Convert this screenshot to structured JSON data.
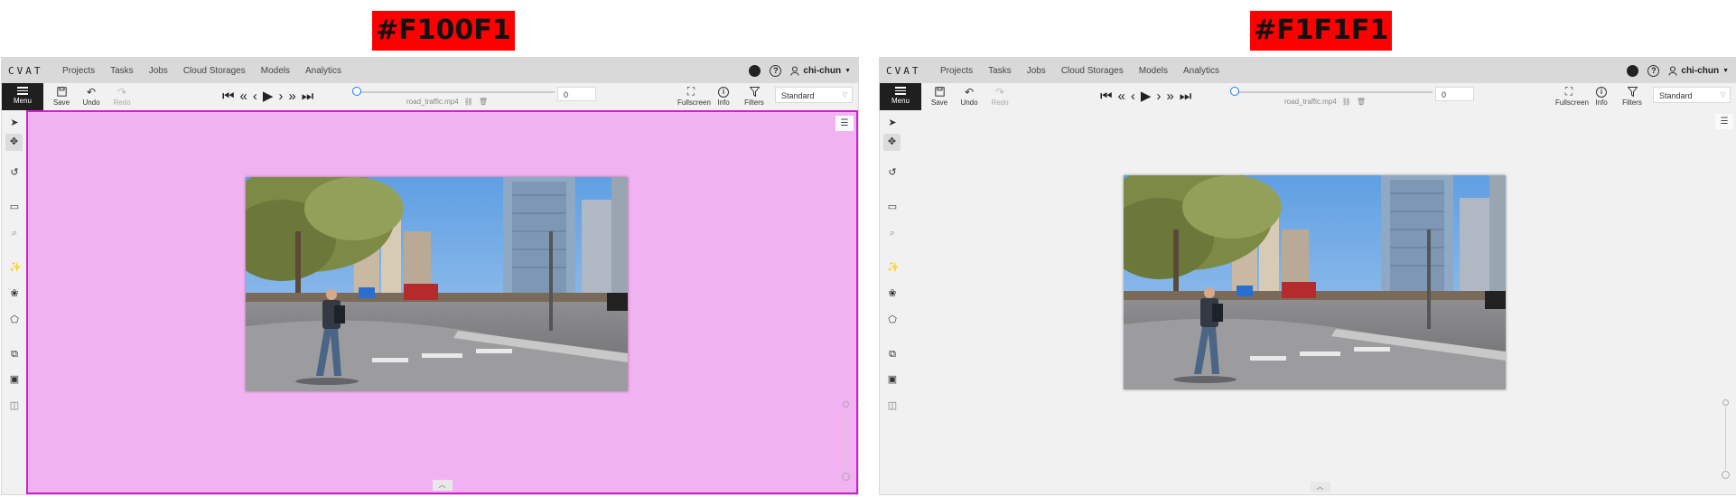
{
  "labels": {
    "left": "#F100F1",
    "right": "#F1F1F1"
  },
  "app": {
    "logo": "CVAT",
    "nav": [
      "Projects",
      "Tasks",
      "Jobs",
      "Cloud Storages",
      "Models",
      "Analytics"
    ],
    "user": "chi-chun",
    "github_icon": "github-icon",
    "help_icon": "help-icon"
  },
  "toolbar": {
    "menu_label": "Menu",
    "save_label": "Save",
    "undo_label": "Undo",
    "redo_label": "Redo",
    "filename": "road_traffic.mp4",
    "frame_value": "0",
    "fullscreen_label": "Fullscreen",
    "info_label": "Info",
    "filters_label": "Filters",
    "workspace_value": "Standard"
  },
  "canvas_colors": {
    "left_background": "#f1b2f1",
    "left_border": "#cc22cc",
    "right_background": "#f1f1f1"
  },
  "sidebar_icons": [
    "cursor-icon",
    "move-icon",
    "rotate-icon",
    "rectangle-icon",
    "fit-zoom-icon",
    "magic-wand-icon",
    "ai-tools-icon",
    "polygon-icon",
    "merge-icon",
    "group-icon",
    "split-icon"
  ]
}
